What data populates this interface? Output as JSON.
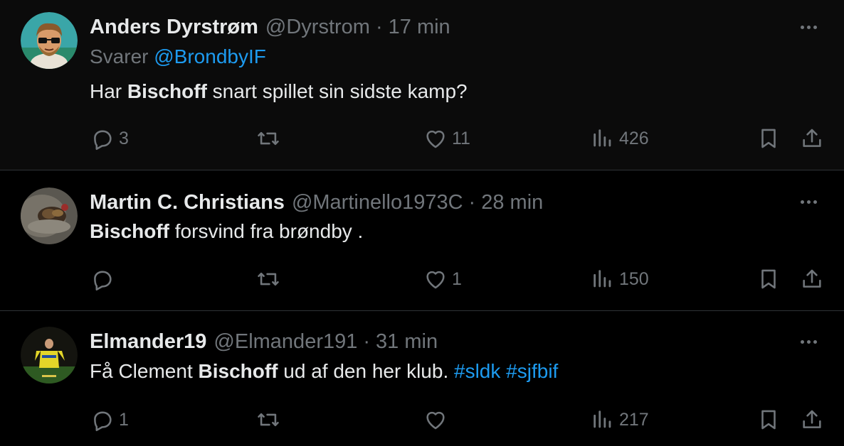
{
  "colors": {
    "background": "#000000",
    "text": "#e7e9ea",
    "muted": "#71767b",
    "accent": "#1d9bf0",
    "divider": "#2f3336"
  },
  "icons": {
    "reply": "reply-bubble-icon",
    "retweet": "retweet-arrows-icon",
    "like": "heart-icon",
    "views": "analytics-bars-icon",
    "bookmark": "bookmark-icon",
    "share": "share-upload-icon",
    "more": "more-dots-icon"
  },
  "tweets": [
    {
      "name": "Anders Dyrstrøm",
      "handle": "@Dyrstrom",
      "separator": "·",
      "time": "17 min",
      "reply_prefix": "Svarer",
      "reply_to": "@BrondbyIF",
      "text_before": "Har ",
      "text_bold": "Bischoff",
      "text_after": " snart spillet sin sidste kamp?",
      "replies": "3",
      "retweets": "",
      "likes": "11",
      "views": "426"
    },
    {
      "name": "Martin C. Christians",
      "handle": "@Martinello1973C",
      "separator": "·",
      "time": "28 min",
      "text_bold": "Bischoff",
      "text_after": " forsvind fra brøndby .",
      "replies": "",
      "retweets": "",
      "likes": "1",
      "views": "150"
    },
    {
      "name": "Elmander19",
      "handle": "@Elmander191",
      "separator": "·",
      "time": "31 min",
      "text_before": "Få Clement ",
      "text_bold": "Bischoff",
      "text_after": " ud af den her klub. ",
      "hashtag1": "#sldk",
      "hashtag2": "#sjfbif",
      "replies": "1",
      "retweets": "",
      "likes": "",
      "views": "217"
    }
  ]
}
